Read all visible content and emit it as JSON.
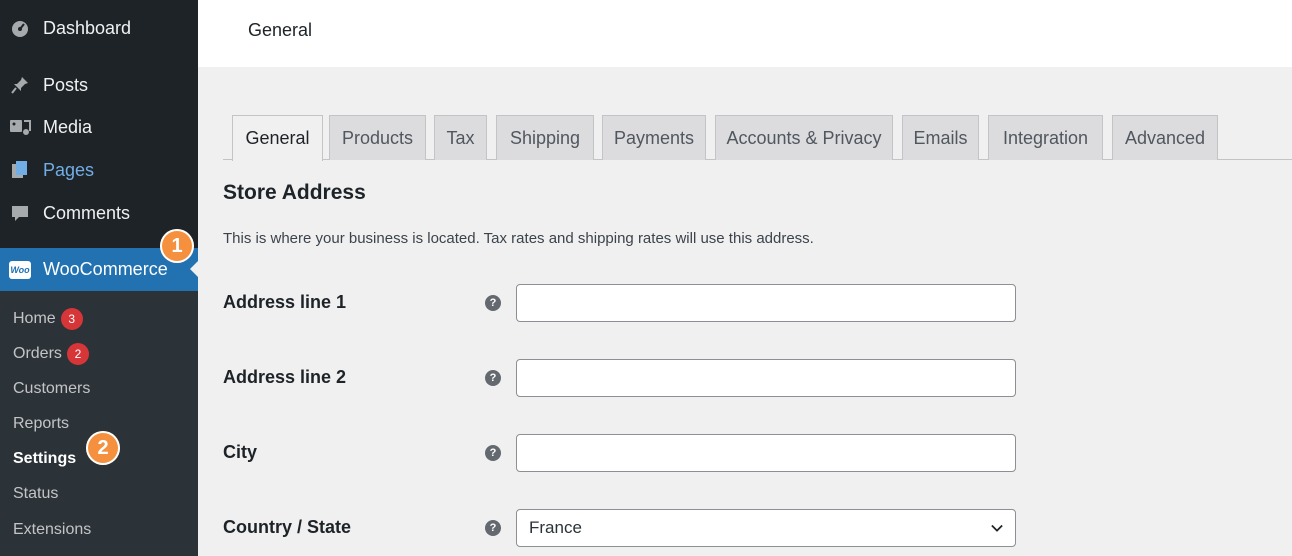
{
  "sidebar": {
    "menu": {
      "dashboard": "Dashboard",
      "posts": "Posts",
      "media": "Media",
      "pages": "Pages",
      "comments": "Comments",
      "woocommerce": "WooCommerce",
      "woo_logo": "Woo"
    },
    "submenu": {
      "home": "Home",
      "home_count": "3",
      "orders": "Orders",
      "orders_count": "2",
      "customers": "Customers",
      "reports": "Reports",
      "settings": "Settings",
      "status": "Status",
      "extensions": "Extensions"
    },
    "markers": {
      "one": "1",
      "two": "2"
    }
  },
  "header": {
    "title": "General"
  },
  "tabs": [
    "General",
    "Products",
    "Tax",
    "Shipping",
    "Payments",
    "Accounts & Privacy",
    "Emails",
    "Integration",
    "Advanced"
  ],
  "section": {
    "title": "Store Address",
    "description": "This is where your business is located. Tax rates and shipping rates will use this address."
  },
  "fields": {
    "address1": {
      "label": "Address line 1",
      "value": ""
    },
    "address2": {
      "label": "Address line 2",
      "value": ""
    },
    "city": {
      "label": "City",
      "value": ""
    },
    "country": {
      "label": "Country / State",
      "value": "France"
    }
  },
  "help_glyph": "?",
  "colors": {
    "sidebar": "#1d2327",
    "submenu": "#2c3338",
    "accent": "#2271b1",
    "badge": "#d63638",
    "marker": "#f5913e"
  }
}
